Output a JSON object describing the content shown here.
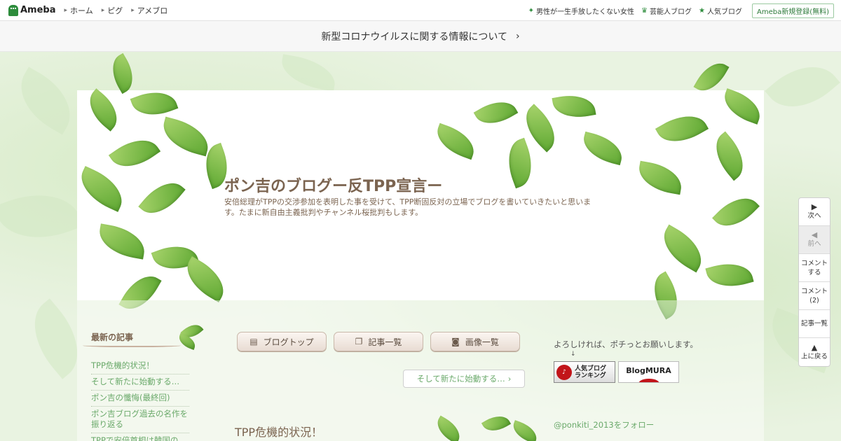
{
  "topbar": {
    "logo": "Ameba",
    "nav": [
      "ホーム",
      "ピグ",
      "アメブロ"
    ],
    "right_links": [
      {
        "label": "男性が一生手放したくない女性",
        "icon": "sparkle-icon"
      },
      {
        "label": "芸能人ブログ",
        "icon": "crown-icon"
      },
      {
        "label": "人気ブログ",
        "icon": "star-icon"
      }
    ],
    "signup": "Ameba新規登録(無料)"
  },
  "notice": {
    "text": "新型コロナウイルスに関する情報について"
  },
  "header": {
    "title": "ポン吉のブログー反TPP宣言ー",
    "description": "安倍総理がTPPの交渉参加を表明した事を受けて、TPP断固反対の立場でブログを書いていきたいと思います。たまに新自由主義批判やチャンネル桜批判もします。"
  },
  "sidebar": {
    "title": "最新の記事",
    "items": [
      "TPP危機的状況！",
      "そして新たに始動する…",
      "ポン吉の懺悔(最終回)",
      "ポン吉ブログ過去の名作を振り返る",
      "TPPで安倍首相は韓国の"
    ]
  },
  "tabs": [
    {
      "label": "ブログトップ",
      "icon": "document-icon"
    },
    {
      "label": "記事一覧",
      "icon": "copy-icon"
    },
    {
      "label": "画像一覧",
      "icon": "camera-icon"
    }
  ],
  "next_article": "そして新たに始動する…",
  "article": {
    "title": "TPP危機的状況！"
  },
  "right": {
    "text": "よろしければ、ポチっとお願いします。",
    "arrow": "↓",
    "banner1": {
      "line1": "人気ブログ",
      "line2": "ランキング"
    },
    "banner2": "BlogMURA",
    "follow": "@ponkiti_2013をフォロー"
  },
  "sidenav": [
    {
      "icon": "▶",
      "label": "次へ",
      "disabled": false
    },
    {
      "icon": "◀",
      "label": "前へ",
      "disabled": true
    },
    {
      "icon": "",
      "label": "コメントする",
      "disabled": false
    },
    {
      "icon": "",
      "label": "コメント(2)",
      "disabled": false
    },
    {
      "icon": "",
      "label": "記事一覧",
      "disabled": false
    },
    {
      "icon": "▲",
      "label": "上に戻る",
      "disabled": false
    }
  ],
  "colors": {
    "accent_green": "#2d8c3c",
    "title_brown": "#7b6450",
    "link_green": "#6aa96a"
  }
}
